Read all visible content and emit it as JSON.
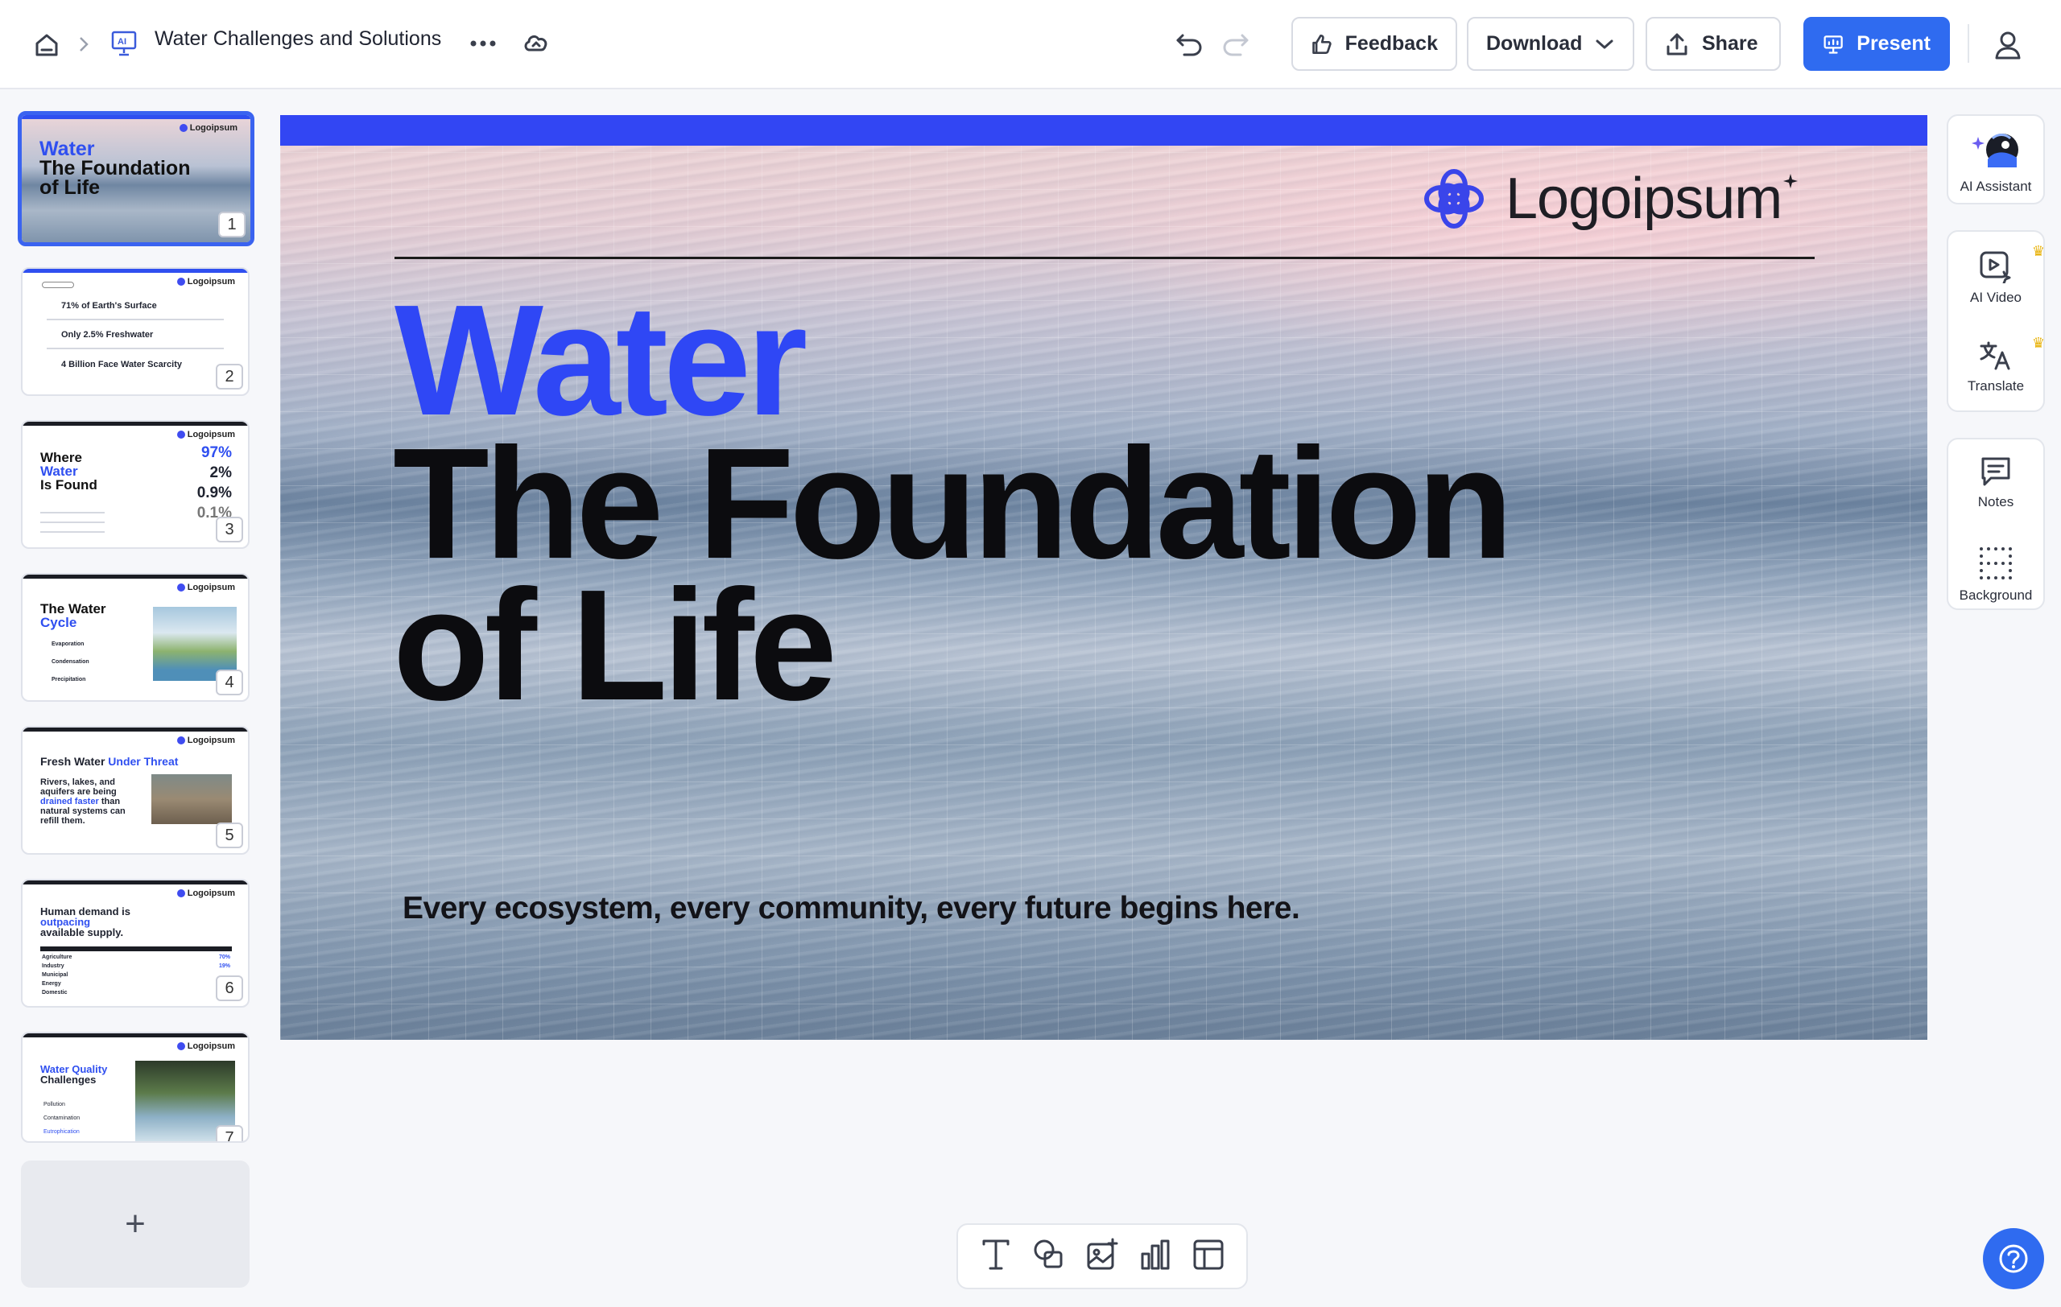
{
  "topbar": {
    "doc_title": "Water Challenges and Solutions",
    "feedback_label": "Feedback",
    "download_label": "Download",
    "share_label": "Share",
    "present_label": "Present"
  },
  "thumbnails": [
    {
      "number": "1",
      "title_blue": "Water",
      "title_rest": "The Foundation of Life"
    },
    {
      "number": "2",
      "rows": [
        "71% of Earth's Surface",
        "Only 2.5% Freshwater",
        "4 Billion Face Water Scarcity"
      ]
    },
    {
      "number": "3",
      "title_a": "Where",
      "title_blue": "Water",
      "title_b": "Is Found",
      "stats": [
        "97%",
        "2%",
        "0.9%",
        "0.1%"
      ]
    },
    {
      "number": "4",
      "title_a": "The Water",
      "title_blue": "Cycle",
      "items": [
        "Evaporation",
        "Condensation",
        "Precipitation"
      ]
    },
    {
      "number": "5",
      "title_a": "Fresh Water",
      "title_blue": "Under Threat",
      "body_a": "Rivers, lakes, and aquifers are being",
      "body_blue": "drained faster",
      "body_b": "than natural systems can refill them."
    },
    {
      "number": "6",
      "title_a": "Human demand is",
      "title_blue": "outpacing",
      "title_b": "available supply.",
      "rows": [
        "Agriculture",
        "Industry",
        "Municipal",
        "Energy",
        "Domestic"
      ],
      "values": [
        "70%",
        "19%"
      ]
    },
    {
      "number": "7",
      "title_blue": "Water Quality",
      "title_b": "Challenges",
      "rows": [
        "Pollution",
        "Contamination",
        "Eutrophication"
      ]
    }
  ],
  "slide": {
    "logo_text": "Logoipsum",
    "headline_blue": "Water",
    "headline_black": "The Foundation of Life",
    "subheadline": "Every ecosystem, every community, every future begins here.",
    "colors": {
      "accent": "#3246f3",
      "text": "#0c0c0f"
    }
  },
  "rail": {
    "ai_assistant": "AI Assistant",
    "ai_video": "AI Video",
    "translate": "Translate",
    "notes": "Notes",
    "background": "Background"
  },
  "add_slide_label": "+",
  "bottom_tools": [
    "text-tool-icon",
    "shapes-tool-icon",
    "image-tool-icon",
    "chart-tool-icon",
    "table-tool-icon"
  ]
}
